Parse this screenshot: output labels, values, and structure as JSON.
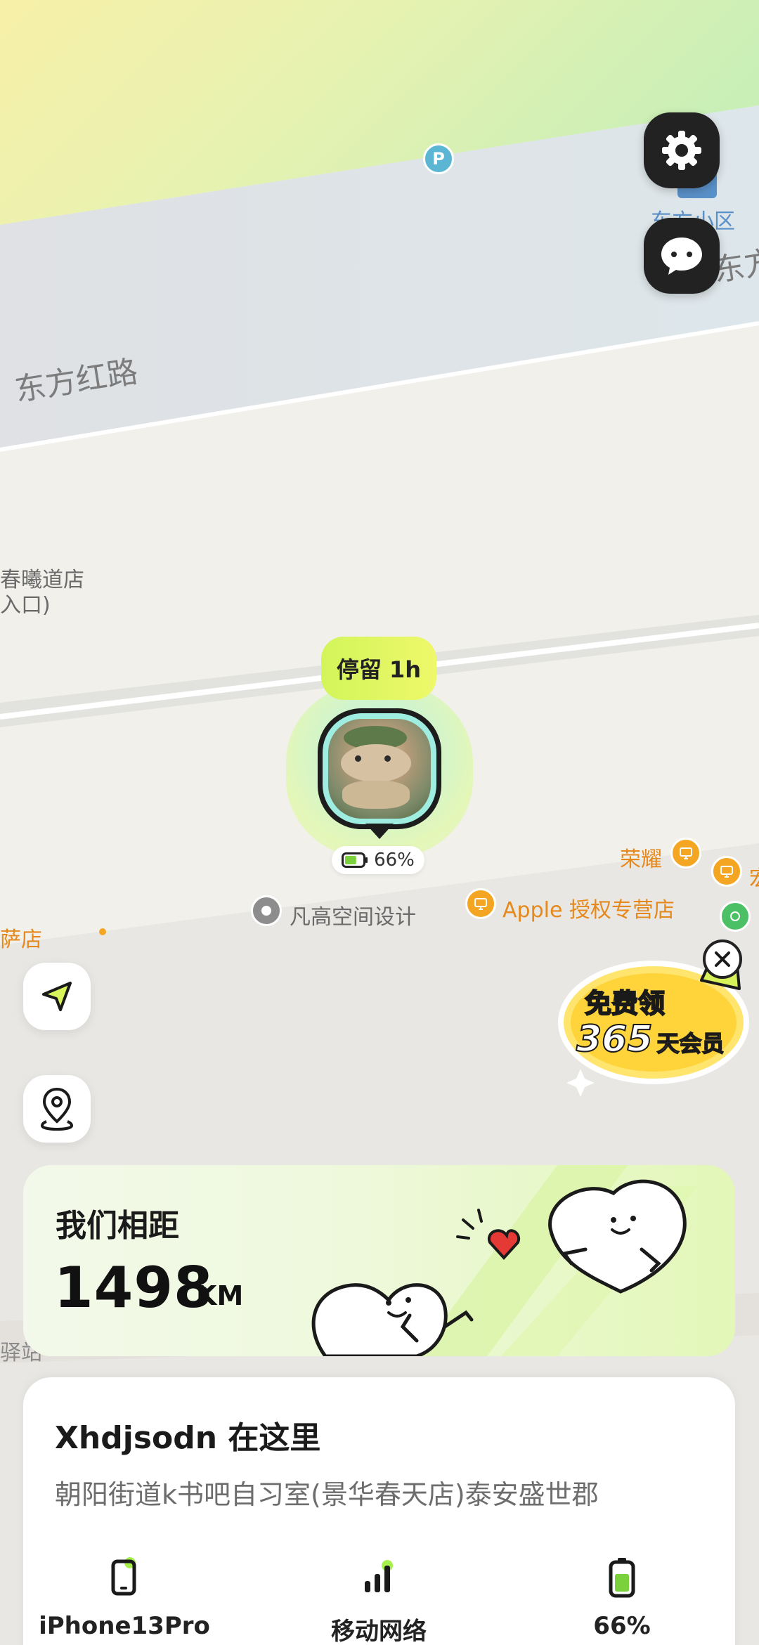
{
  "map": {
    "road_label": "东方红路",
    "road_label_right": "东方红",
    "community_label": "东方小区",
    "shop_partial_label_line1": "春曦道店",
    "shop_partial_label_line2": "入口)",
    "honor_label": "荣耀",
    "apple_store_label": "Apple 授权专营店",
    "design_label": "凡高空间设计",
    "pizza_label": "萨店",
    "station_partial_label": "驿站",
    "parking_letter": "P",
    "right_cut_label": "宏"
  },
  "marker": {
    "stay_text": "停留 1h",
    "battery_text": "66%",
    "battery_level": 0.66
  },
  "promo": {
    "line1": "免费领",
    "line2_number": "365",
    "line2_text": "天会员"
  },
  "distance": {
    "title": "我们相距",
    "value": "1498",
    "unit": "KM"
  },
  "location": {
    "title": "Xhdjsodn 在这里",
    "address": "朝阳街道k书吧自习室(景华春天店)泰安盛世郡"
  },
  "stats": {
    "device": "iPhone13Pro",
    "network": "移动网络",
    "battery": "66%"
  },
  "colors": {
    "accent_green": "#d2f55a",
    "poi_orange": "#f4a623",
    "battery_green": "#7bd13b"
  }
}
